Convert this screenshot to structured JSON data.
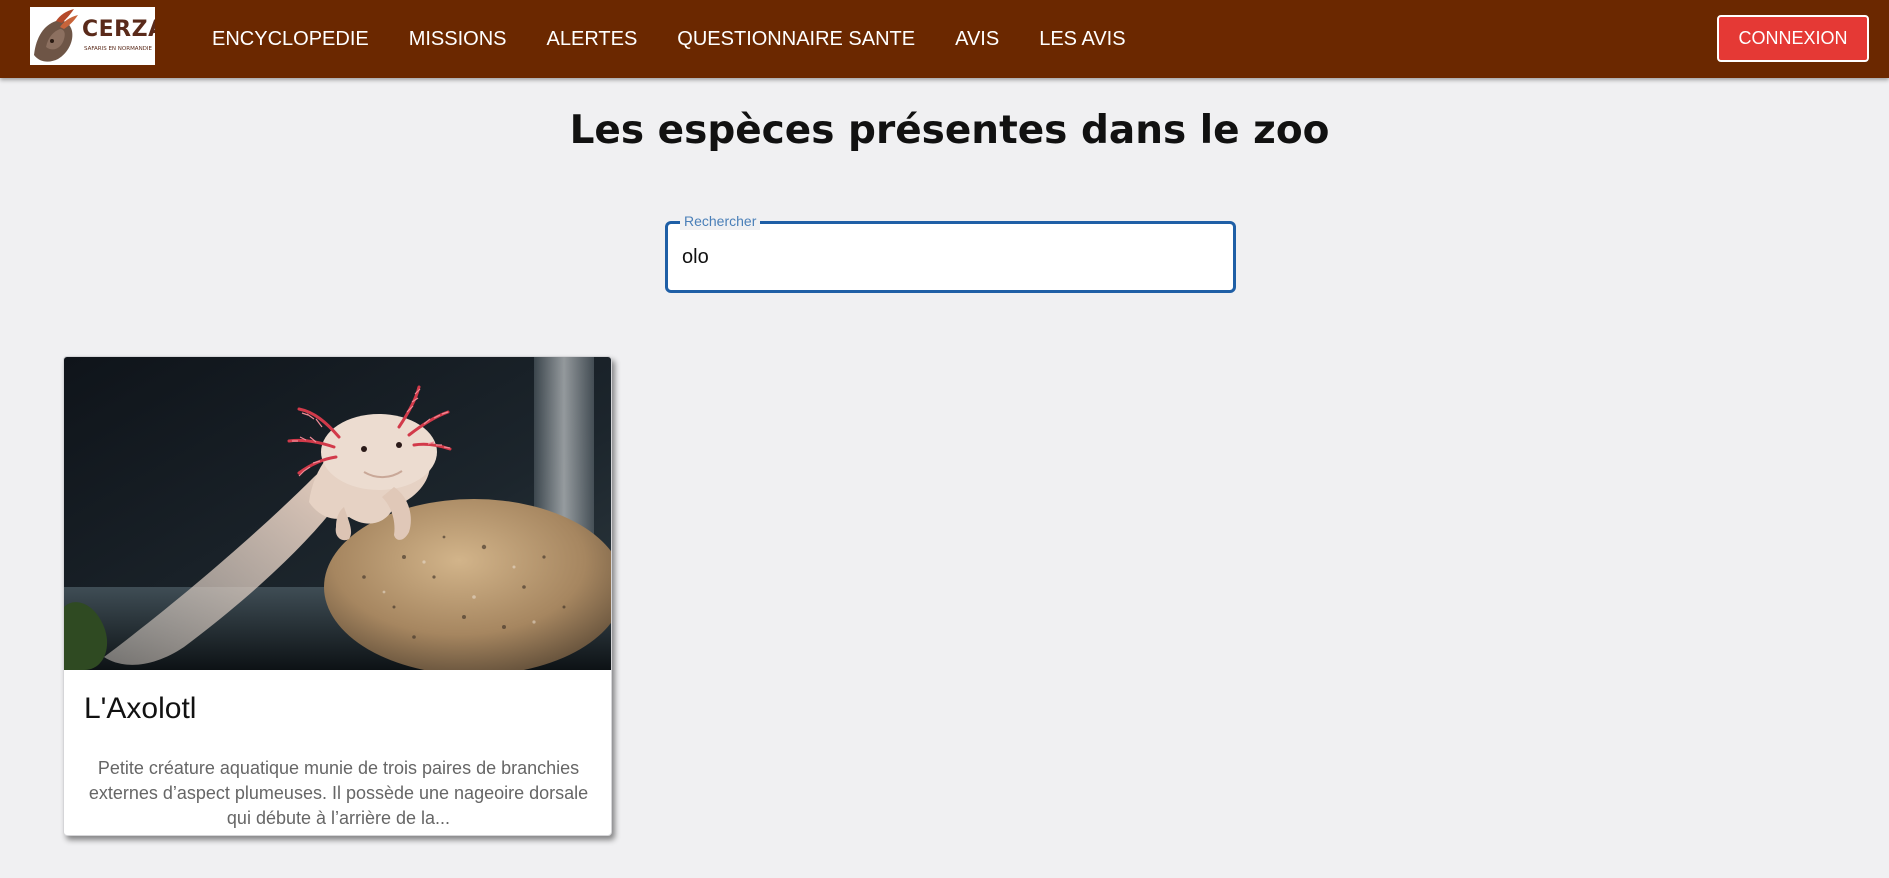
{
  "brand": {
    "name": "CERZA",
    "tagline": "SAFARIS EN NORMANDIE"
  },
  "nav": {
    "items": [
      {
        "label": "ENCYCLOPEDIE"
      },
      {
        "label": "MISSIONS"
      },
      {
        "label": "ALERTES"
      },
      {
        "label": "QUESTIONNAIRE SANTE"
      },
      {
        "label": "AVIS"
      },
      {
        "label": "LES AVIS"
      }
    ],
    "login_label": "CONNEXION"
  },
  "colors": {
    "navbar": "#6b2800",
    "login_button": "#e53935",
    "search_focus": "#1f5fa6",
    "page_background": "#f0f0f2"
  },
  "page": {
    "title": "Les espèces présentes dans le zoo"
  },
  "search": {
    "label": "Rechercher",
    "value": "olo"
  },
  "results": [
    {
      "name": "L'Axolotl",
      "description": "Petite créature aquatique munie de trois paires de branchies externes d’aspect plumeuses. Il possède une nageoire dorsale qui débute à l’arrière de la..."
    }
  ]
}
